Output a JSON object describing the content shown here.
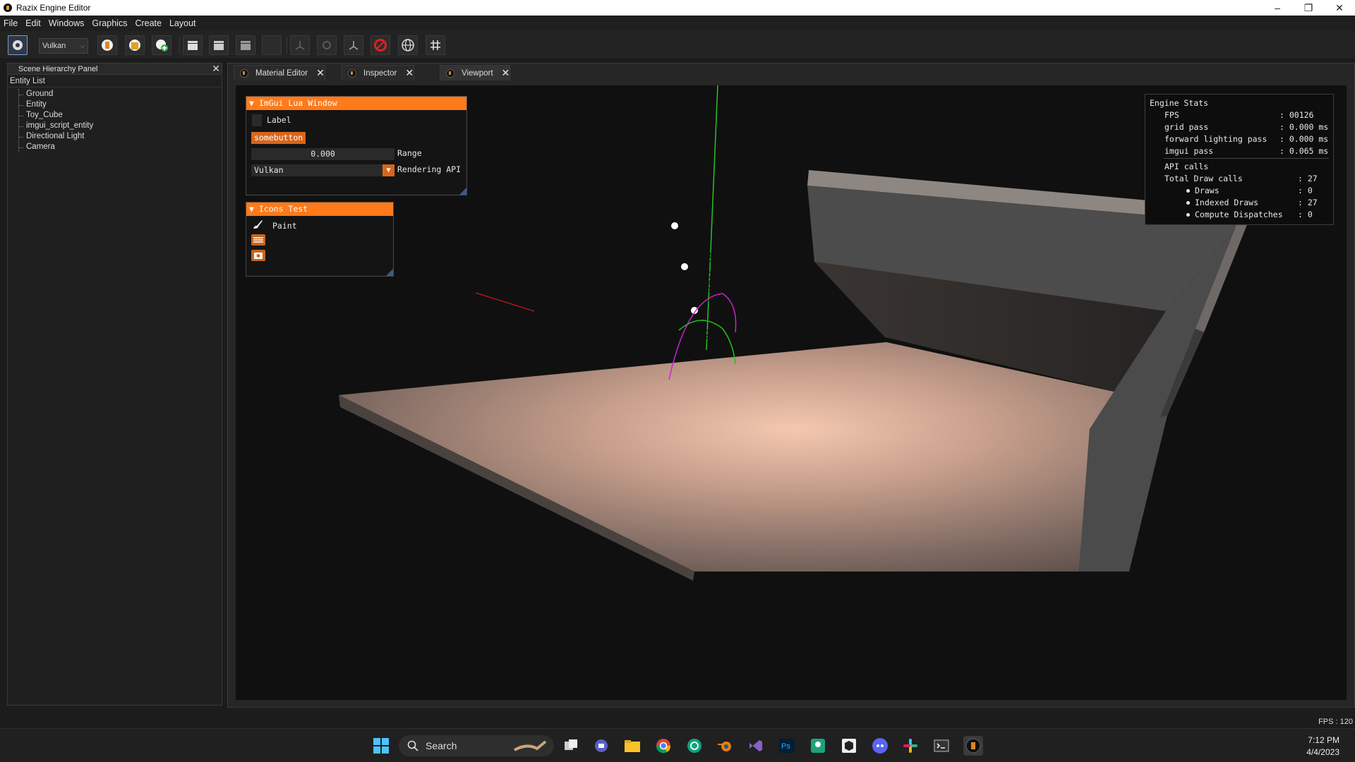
{
  "window": {
    "title": "Razix Engine Editor"
  },
  "menu": [
    "File",
    "Edit",
    "Windows",
    "Graphics",
    "Create",
    "Layout"
  ],
  "toolbar": {
    "render_api": "Vulkan"
  },
  "hierarchy": {
    "panel_title": "Scene Hierarchy Panel",
    "list_title": "Entity List",
    "entities": [
      "Ground",
      "Entity",
      "Toy_Cube",
      "imgui_script_entity",
      "Directional Light",
      "Camera"
    ]
  },
  "tabs": [
    {
      "label": "Material Editor"
    },
    {
      "label": "Inspector"
    },
    {
      "label": "Viewport"
    }
  ],
  "lua_window": {
    "title": "ImGui Lua Window",
    "label": "Label",
    "button": "somebutton",
    "range_value": "0.000",
    "range_label": "Range",
    "api_value": "Vulkan",
    "api_label": "Rendering API"
  },
  "icons_window": {
    "title": "Icons Test",
    "paint_label": "Paint"
  },
  "stats": {
    "title": "Engine Stats",
    "fps_label": "FPS",
    "fps_value": ": 00126",
    "passes": [
      {
        "label": "grid pass",
        "value": ": 0.000 ms"
      },
      {
        "label": "forward lighting pass",
        "value": ": 0.000 ms"
      },
      {
        "label": "imgui pass",
        "value": ": 0.065 ms"
      }
    ],
    "api_calls_label": "API calls",
    "total_draw_label": "Total Draw calls",
    "total_draw_value": ": 27",
    "draws_label": "Draws",
    "draws_value": ": 0",
    "indexed_label": "Indexed Draws",
    "indexed_value": ": 27",
    "compute_label": "Compute Dispatches",
    "compute_value": ": 0"
  },
  "status": {
    "fps": "FPS : 120"
  },
  "taskbar": {
    "search_label": "Search",
    "time": "7:12 PM",
    "date": "4/4/2023"
  },
  "colors": {
    "accent": "#ff7a1a",
    "floor_light": "#f2c4ac",
    "floor_dark": "#5a4a44",
    "wall": "#4a4a4a"
  }
}
